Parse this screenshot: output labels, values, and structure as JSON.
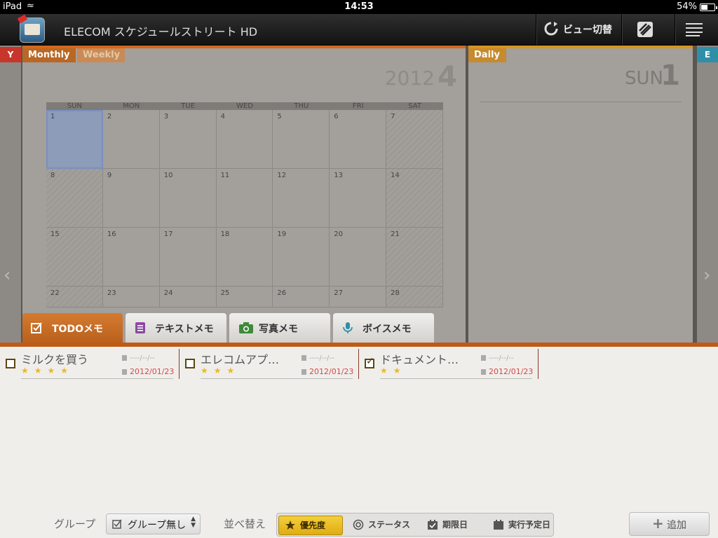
{
  "status": {
    "device": "iPad",
    "time": "14:53",
    "battery": "54%"
  },
  "nav": {
    "title": "ELECOM スケジュールストリート HD",
    "view_switch": "ビュー切替"
  },
  "edges": {
    "left_tab": "Y",
    "right_tab": "E"
  },
  "month_panel": {
    "tabs": [
      "Monthly",
      "Weekly"
    ],
    "year": "2012",
    "month": "4",
    "weekdays": [
      "SUN",
      "MON",
      "TUE",
      "WED",
      "THU",
      "FRI",
      "SAT"
    ],
    "days": [
      "1",
      "2",
      "3",
      "4",
      "5",
      "6",
      "7",
      "8",
      "9",
      "10",
      "11",
      "12",
      "13",
      "14",
      "15",
      "16",
      "17",
      "18",
      "19",
      "20",
      "21",
      "22",
      "23",
      "24",
      "25",
      "26",
      "27",
      "28"
    ]
  },
  "day_panel": {
    "tab": "Daily",
    "weekday": "SUN",
    "day": "1"
  },
  "bottom_tabs": [
    "TODOメモ",
    "テキストメモ",
    "写真メモ",
    "ボイスメモ"
  ],
  "todos": [
    {
      "title": "ミルクを買う",
      "stars": "★★★★",
      "due": "----/--/--",
      "exec": "2012/01/23",
      "checked": false
    },
    {
      "title": "エレコムアプ…",
      "stars": "★★★",
      "due": "----/--/--",
      "exec": "2012/01/23",
      "checked": false
    },
    {
      "title": "ドキュメント…",
      "stars": "★★",
      "due": "----/--/--",
      "exec": "2012/01/23",
      "checked": true
    }
  ],
  "toolbar": {
    "group_label": "グループ",
    "group_value": "グループ無し",
    "sort_label": "並べ替え",
    "sort_options": [
      "優先度",
      "ステータス",
      "期限日",
      "実行予定日"
    ],
    "add_label": "追加"
  },
  "colors": {
    "accent": "#c05a16",
    "monthly": "#d06a1c",
    "daily": "#d8931e",
    "star": "#e7b92f",
    "date_red": "#d24a4a",
    "selected_sort": "#e1ac13"
  }
}
